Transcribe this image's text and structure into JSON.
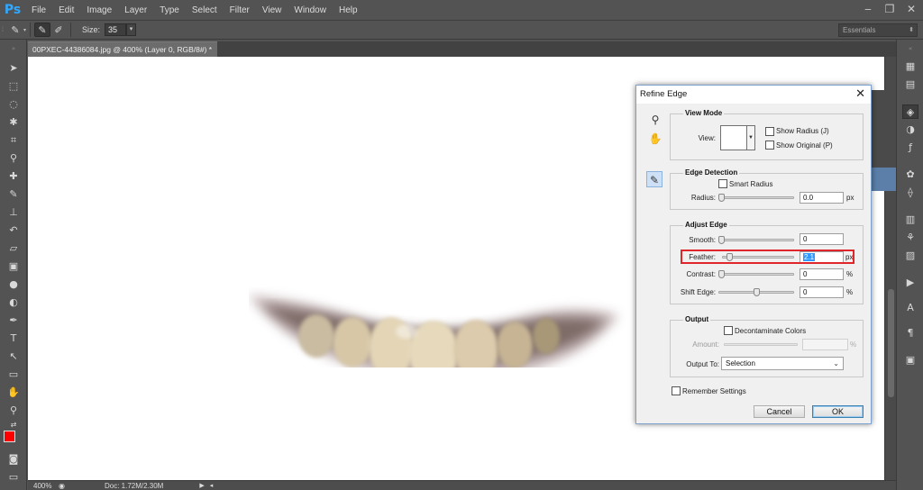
{
  "app": {
    "logo": "Ps",
    "menu": [
      "File",
      "Edit",
      "Image",
      "Layer",
      "Type",
      "Select",
      "Filter",
      "View",
      "Window",
      "Help"
    ],
    "window_controls": [
      "‒",
      "❐",
      "✕"
    ]
  },
  "options": {
    "size_label": "Size:",
    "size_value": "35",
    "workspace": "Essentials"
  },
  "document": {
    "tab_title": "00PXEC-44386084.jpg @ 400% (Layer 0, RGB/8#) *",
    "zoom": "400%",
    "doc_info": "Doc: 1.72M/2.30M"
  },
  "colors": {
    "foreground": "#ff0000",
    "background": "#000000",
    "accent": "#3399ff",
    "highlight": "#e0252b"
  },
  "dialog": {
    "title": "Refine Edge",
    "close": "✕",
    "view_mode": {
      "title": "View Mode",
      "view_label": "View:",
      "show_radius": "Show Radius (J)",
      "show_original": "Show Original (P)"
    },
    "edge_detection": {
      "title": "Edge Detection",
      "smart_radius": "Smart Radius",
      "radius_label": "Radius:",
      "radius_value": "0.0",
      "radius_unit": "px"
    },
    "adjust_edge": {
      "title": "Adjust Edge",
      "smooth_label": "Smooth:",
      "smooth_value": "0",
      "feather_label": "Feather:",
      "feather_value": "2.1",
      "feather_unit": "px",
      "contrast_label": "Contrast:",
      "contrast_value": "0",
      "contrast_unit": "%",
      "shift_label": "Shift Edge:",
      "shift_value": "0",
      "shift_unit": "%"
    },
    "output": {
      "title": "Output",
      "decontaminate": "Decontaminate Colors",
      "amount_label": "Amount:",
      "amount_unit": "%",
      "output_to_label": "Output To:",
      "output_to_value": "Selection"
    },
    "remember": "Remember Settings",
    "cancel": "Cancel",
    "ok": "OK"
  }
}
